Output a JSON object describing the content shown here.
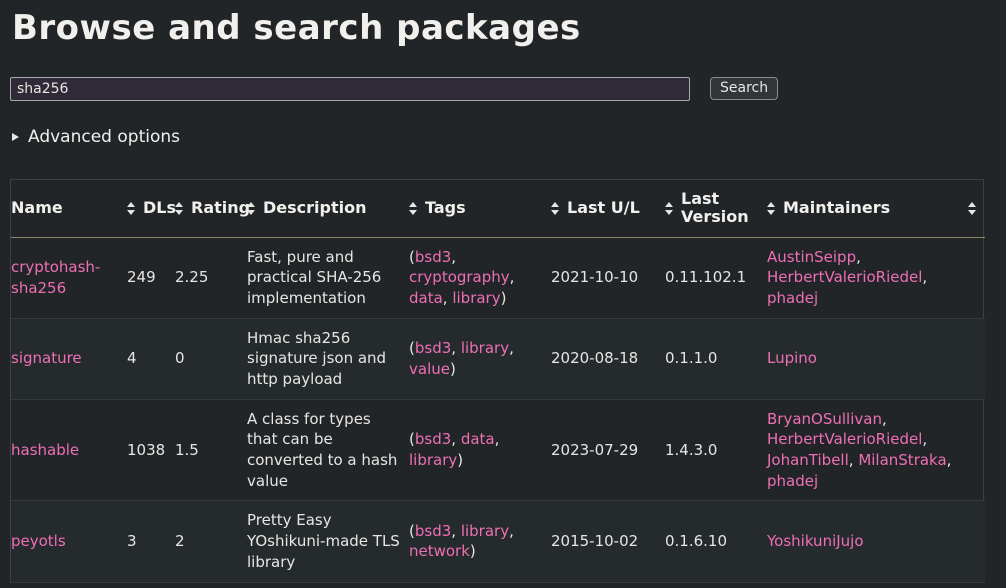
{
  "page": {
    "title": "Browse and search packages",
    "background_color": "#212528",
    "link_color": "#ee6fb4",
    "text_color": "#e8e6e3",
    "header_rule_color": "#8d8565"
  },
  "search": {
    "input_value": "sha256",
    "input_placeholder": "",
    "button_label": "Search"
  },
  "advanced": {
    "label": "Advanced options",
    "marker_icon": "disclosure-triangle-right-icon",
    "expanded": false
  },
  "table": {
    "sort_icon": "sort-updown-icon",
    "columns": [
      {
        "key": "name",
        "label": "Name",
        "sortable": true,
        "sort_icon_after": true
      },
      {
        "key": "dls",
        "label": "DLs",
        "sortable": true
      },
      {
        "key": "rating",
        "label": "Rating",
        "sortable": true
      },
      {
        "key": "description",
        "label": "Description",
        "sortable": true
      },
      {
        "key": "tags",
        "label": "Tags",
        "sortable": true
      },
      {
        "key": "last_ul",
        "label": "Last U/L",
        "sortable": true
      },
      {
        "key": "last_version",
        "label": "Last Version",
        "sortable": true
      },
      {
        "key": "maintainers",
        "label": "Maintainers",
        "sortable": true
      }
    ],
    "rows": [
      {
        "name": "cryptohash-sha256",
        "dls": "249",
        "rating": "2.25",
        "description": "Fast, pure and practical SHA-256 implementation",
        "tags": [
          "bsd3",
          "cryptography",
          "data",
          "library"
        ],
        "last_ul": "2021-10-10",
        "last_version": "0.11.102.1",
        "maintainers": [
          "AustinSeipp",
          "HerbertValerioRiedel",
          "phadej"
        ]
      },
      {
        "name": "signature",
        "dls": "4",
        "rating": "0",
        "description": "Hmac sha256 signature json and http payload",
        "tags": [
          "bsd3",
          "library",
          "value"
        ],
        "last_ul": "2020-08-18",
        "last_version": "0.1.1.0",
        "maintainers": [
          "Lupino"
        ]
      },
      {
        "name": "hashable",
        "dls": "1038",
        "rating": "1.5",
        "description": "A class for types that can be converted to a hash value",
        "tags": [
          "bsd3",
          "data",
          "library"
        ],
        "last_ul": "2023-07-29",
        "last_version": "1.4.3.0",
        "maintainers": [
          "BryanOSullivan",
          "HerbertValerioRiedel",
          "JohanTibell",
          "MilanStraka",
          "phadej"
        ]
      },
      {
        "name": "peyotls",
        "dls": "3",
        "rating": "2",
        "description": "Pretty Easy YOshikuni-made TLS library",
        "tags": [
          "bsd3",
          "library",
          "network"
        ],
        "last_ul": "2015-10-02",
        "last_version": "0.1.6.10",
        "maintainers": [
          "YoshikuniJujo"
        ]
      }
    ]
  }
}
